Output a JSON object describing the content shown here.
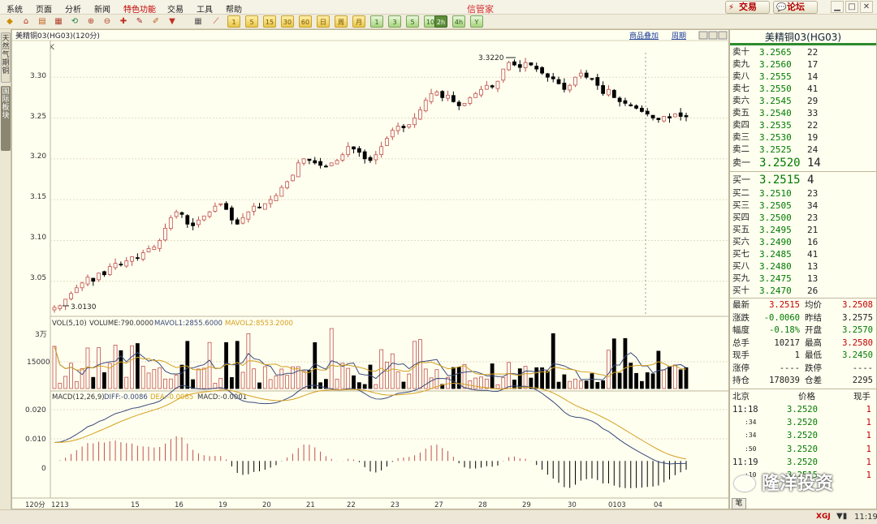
{
  "menu": [
    "系统",
    "页面",
    "分析",
    "新闻",
    "特色功能",
    "交易",
    "工具",
    "帮助"
  ],
  "app_title": "信管家",
  "top_buttons": {
    "trade": "交易",
    "forum": "论坛"
  },
  "toolbar_periods": [
    "1",
    "5",
    "15",
    "30",
    "60",
    "日",
    "周",
    "月",
    "年",
    "季",
    "1",
    "3",
    "5",
    "10",
    "30",
    "60",
    "2h",
    "4h",
    "Y"
  ],
  "left_tabs": [
    "天然气期铜",
    "国际板块"
  ],
  "chart": {
    "header": "美精铜03(HG03)(120分)",
    "type_label": "K",
    "links": {
      "overlay": "商品叠加",
      "period": "周期"
    },
    "price_ticks": [
      "3.30",
      "3.25",
      "3.20",
      "3.15",
      "3.10",
      "3.05"
    ],
    "high_annotation": "3.3220",
    "low_annotation": "3.0130",
    "volume_header": {
      "title": "VOL(5,10)",
      "volume": "VOLUME:790.0000",
      "mavol1": "MAVOL1:2855.6000",
      "mavol2": "MAVOL2:8553.2000"
    },
    "volume_ticks": [
      "3万",
      "15000"
    ],
    "macd_header": {
      "title": "MACD(12,26,9)",
      "diff": "DIFF:-0.0086",
      "dea": "DEA:-0.0085",
      "macd": "MACD:-0.0001"
    },
    "macd_ticks": [
      "0.020",
      "0.010",
      "0"
    ],
    "x_period_label": "120分",
    "x_labels": [
      "1213",
      "15",
      "16",
      "19",
      "20",
      "21",
      "22",
      "23",
      "27",
      "28",
      "29",
      "30",
      "0103",
      "04"
    ],
    "colors": {
      "up": "#c0504d",
      "down": "#000000",
      "diff": "#3a4a7a",
      "dea": "#d4a020",
      "mavol1": "#3a4a7a",
      "mavol2": "#d4a020"
    }
  },
  "chart_data": {
    "type": "candlestick",
    "title": "美精铜03(HG03)(120分)",
    "y_range": [
      3.01,
      3.33
    ],
    "close": [
      3.018,
      3.02,
      3.028,
      3.035,
      3.042,
      3.048,
      3.055,
      3.05,
      3.06,
      3.058,
      3.068,
      3.072,
      3.07,
      3.075,
      3.08,
      3.078,
      3.085,
      3.09,
      3.092,
      3.1,
      3.115,
      3.128,
      3.135,
      3.132,
      3.12,
      3.118,
      3.125,
      3.13,
      3.135,
      3.142,
      3.145,
      3.138,
      3.125,
      3.12,
      3.128,
      3.135,
      3.142,
      3.14,
      3.145,
      3.15,
      3.155,
      3.165,
      3.172,
      3.18,
      3.195,
      3.2,
      3.198,
      3.195,
      3.192,
      3.19,
      3.195,
      3.198,
      3.205,
      3.215,
      3.212,
      3.208,
      3.2,
      3.198,
      3.205,
      3.215,
      3.225,
      3.235,
      3.24,
      3.238,
      3.242,
      3.25,
      3.26,
      3.272,
      3.28,
      3.282,
      3.275,
      3.278,
      3.27,
      3.265,
      3.268,
      3.275,
      3.28,
      3.285,
      3.29,
      3.288,
      3.295,
      3.31,
      3.318,
      3.315,
      3.312,
      3.318,
      3.315,
      3.31,
      3.305,
      3.3,
      3.298,
      3.292,
      3.285,
      3.29,
      3.3,
      3.305,
      3.3,
      3.298,
      3.29,
      3.28,
      3.285,
      3.275,
      3.27,
      3.268,
      3.265,
      3.262,
      3.258,
      3.255,
      3.25,
      3.248,
      3.252,
      3.25,
      3.255,
      3.252,
      3.2515
    ],
    "volume_ymax": 30000,
    "macd_range": [
      -0.015,
      0.025
    ]
  },
  "quote": {
    "name": "美精铜03(HG03)",
    "asks": [
      {
        "label": "卖十",
        "price": "3.2565",
        "vol": "22"
      },
      {
        "label": "卖九",
        "price": "3.2560",
        "vol": "17"
      },
      {
        "label": "卖八",
        "price": "3.2555",
        "vol": "14"
      },
      {
        "label": "卖七",
        "price": "3.2550",
        "vol": "41"
      },
      {
        "label": "卖六",
        "price": "3.2545",
        "vol": "29"
      },
      {
        "label": "卖五",
        "price": "3.2540",
        "vol": "33"
      },
      {
        "label": "卖四",
        "price": "3.2535",
        "vol": "22"
      },
      {
        "label": "卖三",
        "price": "3.2530",
        "vol": "19"
      },
      {
        "label": "卖二",
        "price": "3.2525",
        "vol": "24"
      },
      {
        "label": "卖一",
        "price": "3.2520",
        "vol": "14"
      }
    ],
    "bids": [
      {
        "label": "买一",
        "price": "3.2515",
        "vol": "4"
      },
      {
        "label": "买二",
        "price": "3.2510",
        "vol": "23"
      },
      {
        "label": "买三",
        "price": "3.2505",
        "vol": "34"
      },
      {
        "label": "买四",
        "price": "3.2500",
        "vol": "23"
      },
      {
        "label": "买五",
        "price": "3.2495",
        "vol": "21"
      },
      {
        "label": "买六",
        "price": "3.2490",
        "vol": "16"
      },
      {
        "label": "买七",
        "price": "3.2485",
        "vol": "41"
      },
      {
        "label": "买八",
        "price": "3.2480",
        "vol": "13"
      },
      {
        "label": "买九",
        "price": "3.2475",
        "vol": "13"
      },
      {
        "label": "买十",
        "price": "3.2470",
        "vol": "26"
      }
    ],
    "stats": [
      {
        "l1": "最新",
        "v1": "3.2515",
        "c1": "#c00000",
        "l2": "均价",
        "v2": "3.2508",
        "c2": "#c00000"
      },
      {
        "l1": "涨跌",
        "v1": "-0.0060",
        "c1": "#007a00",
        "l2": "昨结",
        "v2": "3.2575",
        "c2": "#222"
      },
      {
        "l1": "幅度",
        "v1": "-0.18%",
        "c1": "#007a00",
        "l2": "开盘",
        "v2": "3.2570",
        "c2": "#007a00"
      },
      {
        "l1": "总手",
        "v1": "10217",
        "c1": "#222",
        "l2": "最高",
        "v2": "3.2580",
        "c2": "#c00000"
      },
      {
        "l1": "现手",
        "v1": "1",
        "c1": "#222",
        "l2": "最低",
        "v2": "3.2450",
        "c2": "#007a00"
      },
      {
        "l1": "涨停",
        "v1": "----",
        "c1": "#222",
        "l2": "跌停",
        "v2": "----",
        "c2": "#222"
      },
      {
        "l1": "持仓",
        "v1": "178039",
        "c1": "#222",
        "l2": "仓差",
        "v2": "2295",
        "c2": "#222"
      }
    ],
    "trades_header": {
      "city": "北京",
      "price": "价格",
      "vol": "现手"
    },
    "trades": [
      {
        "time": "11:18",
        "price": "3.2520",
        "vol": "1"
      },
      {
        "time": ":34",
        "price": "3.2520",
        "vol": "1"
      },
      {
        "time": ":34",
        "price": "3.2520",
        "vol": "1"
      },
      {
        "time": ":50",
        "price": "3.2520",
        "vol": "1"
      },
      {
        "time": "11:19",
        "price": "3.2520",
        "vol": "1"
      },
      {
        "time": ":10",
        "price": "3.2515",
        "vol": "1"
      }
    ],
    "bottom_tab": "笔"
  },
  "status": {
    "brand": "XGJ",
    "time": "11:19"
  },
  "watermark": "隆洋投资"
}
